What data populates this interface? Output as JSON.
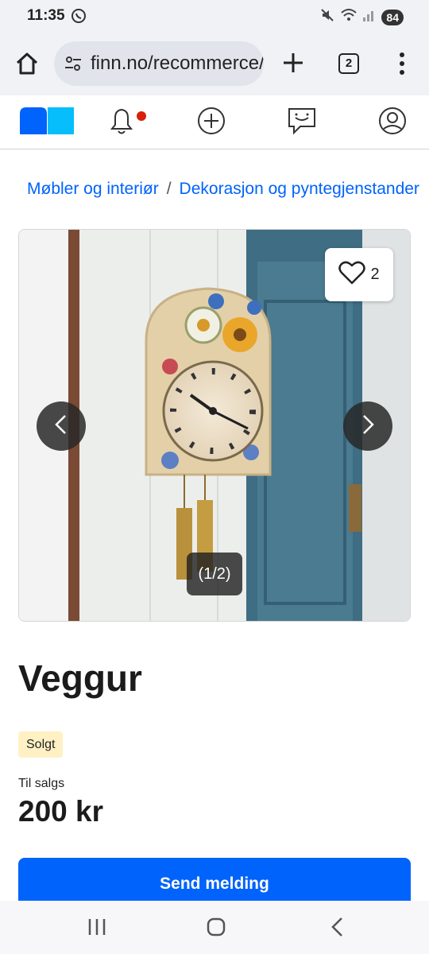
{
  "status": {
    "time": "11:35",
    "battery": "84",
    "icons": [
      "whatsapp-icon",
      "mute-icon",
      "wifi-icon",
      "signal-icon"
    ]
  },
  "browser": {
    "url": "finn.no/recommerce/forsale/item",
    "tab_count": "2",
    "icons": [
      "home-icon",
      "tune-icon",
      "plus-icon",
      "menu-dots-icon"
    ]
  },
  "nav": {
    "icons": [
      "finn-logo",
      "bell-icon",
      "add-circle-icon",
      "message-icon",
      "profile-icon"
    ],
    "notification_color": "#d91f0a"
  },
  "breadcrumb": {
    "items": [
      "Møbler og interiør",
      "Dekorasjon og pyntegjenstander"
    ],
    "separator": "/"
  },
  "gallery": {
    "favorites": "2",
    "counter": "(1/2)"
  },
  "listing": {
    "title": "Veggur",
    "status_badge": "Solgt",
    "sale_label": "Til salgs",
    "price": "200 kr",
    "send_button": "Send melding"
  },
  "colors": {
    "accent": "#0063fb",
    "badge_bg": "#fff1c4",
    "logo_dark": "#0063fb",
    "logo_light": "#06befb"
  }
}
